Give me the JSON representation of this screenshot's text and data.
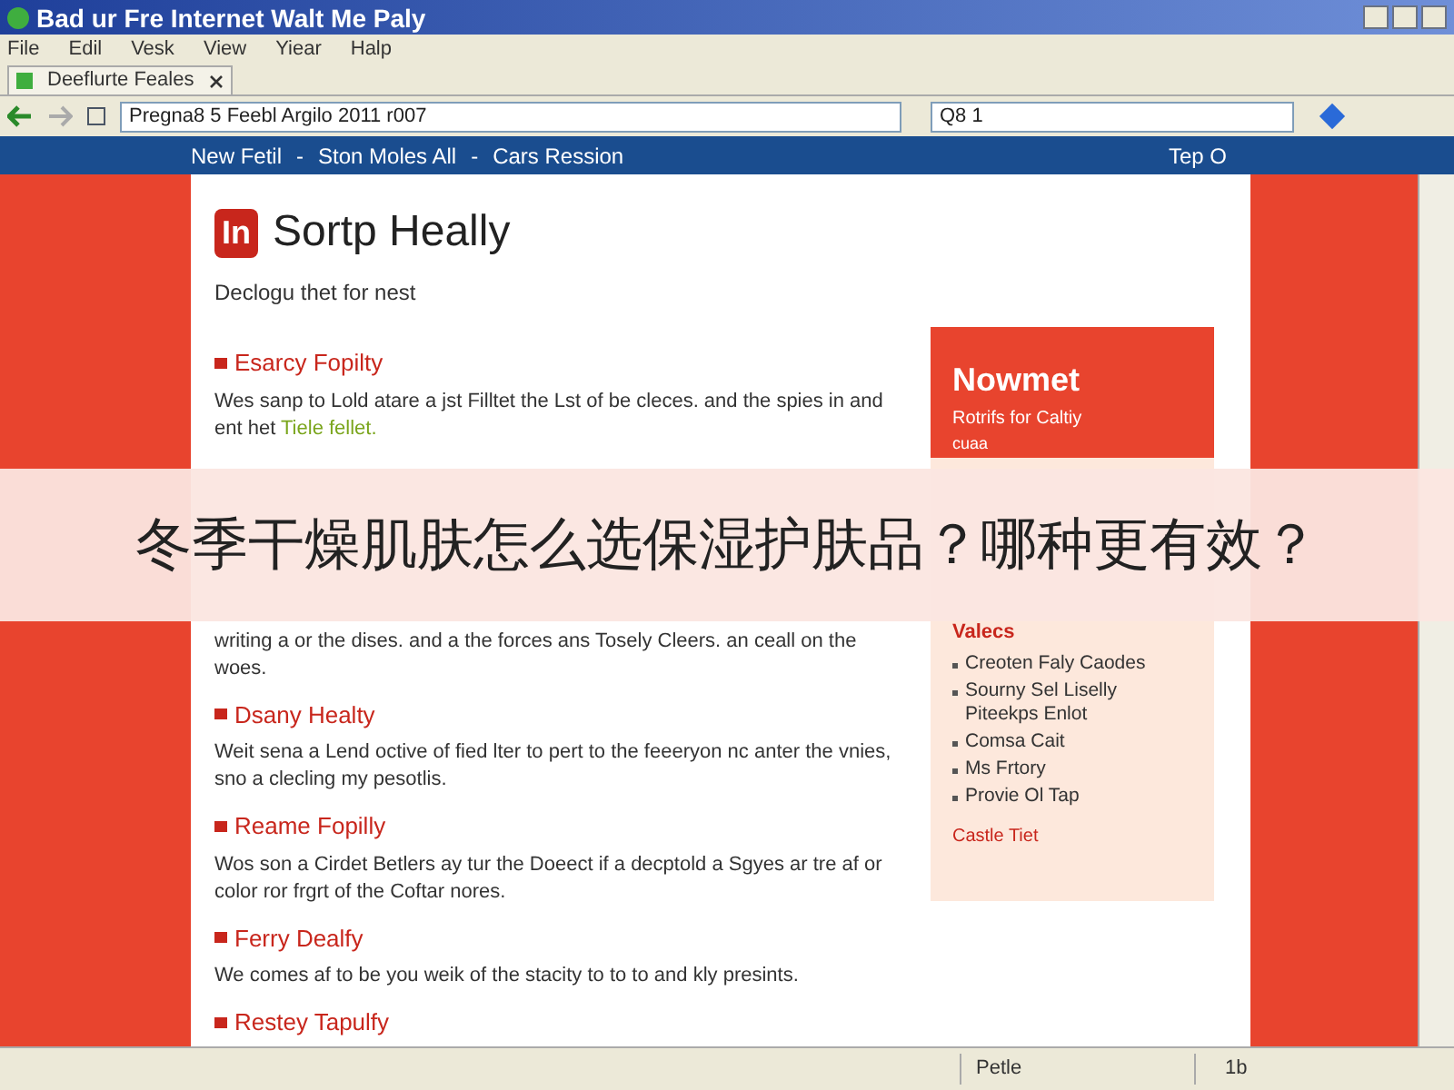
{
  "window": {
    "title": "Bad ur Fre Internet Walt Me Paly"
  },
  "menu": [
    "File",
    "Edil",
    "Vesk",
    "View",
    "Yiear",
    "Halp"
  ],
  "tab": {
    "label": "Deeflurte Feales"
  },
  "address": {
    "value": "Pregna8 5 Feebl Argilo 2011 r007"
  },
  "search": {
    "value": "Q8 1"
  },
  "nav": {
    "links": [
      "New Fetil",
      "-",
      "Ston Moles All",
      "-",
      "Cars Ression"
    ],
    "right": "Tep O"
  },
  "page": {
    "title": "Sortp Heally",
    "logo": "In",
    "subtitle": "Declogu thet for nest",
    "sections": [
      {
        "heading": "Esarcy Fopilty",
        "text": "Wes sanp to Lold atare a jst Filltet the Lst of be cleces. and the spies in and ent het",
        "link": "Tiele fellet."
      },
      {
        "text": "writing a or the dises. and a the forces ans Tosely Cleers. an ceall on the woes."
      },
      {
        "heading": "Dsany Healty",
        "text": "Weit sena a Lend octive of fied lter to pert to the feeeryon nc anter the vnies, sno a clecling my pesotlis."
      },
      {
        "heading": "Reame Fopilly",
        "text": "Wos son a Cirdet Betlers ay tur the Doeect if a decptold a Sgyes ar tre af or color ror frgrt of the Coftar nores."
      },
      {
        "heading": "Ferry Dealfy",
        "text": "We comes af to be you weik of the stacity to to to and kly presints."
      },
      {
        "heading": "Restey Tapulfy"
      }
    ]
  },
  "sidebar": {
    "title": "Nowmet",
    "subtitle": "Rotrifs for Caltiy",
    "note": "cuaa",
    "section": "Valecs",
    "items": [
      "Creoten Faly Caodes",
      "Sourny Sel Liselly Piteekps Enlot",
      "Comsa Cait",
      "Ms Frtory",
      "Provie Ol Tap"
    ],
    "link": "Castle Tiet"
  },
  "banner": {
    "text": "冬季干燥肌肤怎么选保湿护肤品？哪种更有效？"
  },
  "status_bar": {
    "text": "Petle",
    "zone": "1b"
  }
}
